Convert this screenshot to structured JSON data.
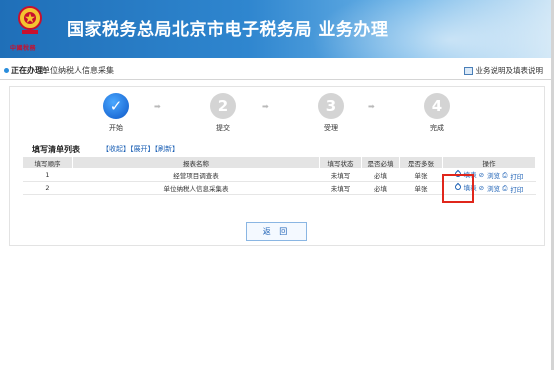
{
  "header": {
    "title": "国家税务总局北京市电子税务局  业务办理",
    "emblem_text": "中國稅務",
    "emblem_icon": "tax-emblem-icon"
  },
  "status": {
    "label": "正在办理：",
    "value": "单位纳税人信息采集",
    "help_label": "业务说明及填表说明",
    "help_icon": "book-icon"
  },
  "steps": [
    {
      "number": "✓",
      "label": "开始",
      "state": "done"
    },
    {
      "number": "2",
      "label": "提交",
      "state": "pending"
    },
    {
      "number": "3",
      "label": "受理",
      "state": "pending"
    },
    {
      "number": "4",
      "label": "完成",
      "state": "pending"
    }
  ],
  "list": {
    "title": "填写清单列表",
    "collapse": "【收起】",
    "expand": "【展开】",
    "refresh": "【刷新】"
  },
  "table": {
    "columns": [
      "填写顺序",
      "报表名称",
      "填写状态",
      "是否必填",
      "是否多张",
      "操作"
    ],
    "rows": [
      {
        "order": "1",
        "name": "经营项目调查表",
        "status": "未填写",
        "required": "必填",
        "multiple": "单张",
        "fill": "填表",
        "browse": "浏览",
        "print": "打印"
      },
      {
        "order": "2",
        "name": "单位纳税人信息采集表",
        "status": "未填写",
        "required": "必填",
        "multiple": "单张",
        "fill": "填表",
        "browse": "浏览",
        "print": "打印"
      }
    ]
  },
  "back_button": "返 回",
  "colors": {
    "accent": "#1f6fd8",
    "highlight": "#e0261b",
    "link": "#1a5fb4"
  }
}
